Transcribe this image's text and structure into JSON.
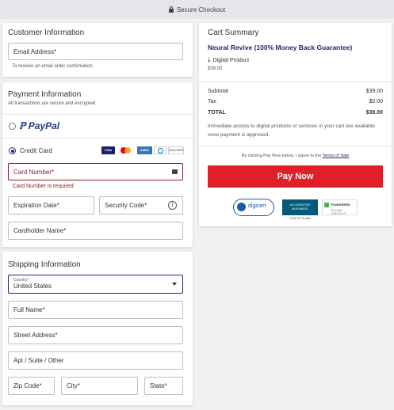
{
  "topbar": {
    "title": "Secure Checkout"
  },
  "customer": {
    "title": "Customer Information",
    "email_label": "Email Address*",
    "email_hint": "To receive an email order confirmation."
  },
  "payment": {
    "title": "Payment Information",
    "subtitle": "All transactions are secure and encrypted.",
    "paypal": "PayPal",
    "credit_card": "Credit Card",
    "card_icons": [
      "VISA",
      "mastercard",
      "AMEX",
      "diners",
      "DISCOVER"
    ],
    "card_number_label": "Card Number*",
    "card_number_error": "Card Number is required",
    "expiration_label": "Expiration Date*",
    "security_label": "Security Code*",
    "cardholder_label": "Cardholder Name*"
  },
  "shipping": {
    "title": "Shipping Information",
    "country_label": "Country*",
    "country_value": "United States",
    "full_name_label": "Full Name*",
    "street_label": "Street Address*",
    "apt_label": "Apt / Suite / Other",
    "zip_label": "Zip Code*",
    "city_label": "City*",
    "state_label": "State*"
  },
  "summary": {
    "title": "Cart Summary",
    "product_name": "Neural Revive (100% Money Back Guarantee)",
    "product_type": "Digital Product",
    "product_price": "$39.00",
    "subtotal_label": "Subtotal",
    "subtotal_value": "$39.00",
    "tax_label": "Tax",
    "tax_value": "$0.00",
    "total_label": "TOTAL",
    "total_value": "$39.00",
    "access_note": "Immediate access to digital products or services in your cart are available once payment is approved.",
    "terms_prefix": "By clicking Pay Now below, I agree to the",
    "terms_link": "Terms of Sale",
    "pay_button": "Pay Now",
    "badges": {
      "digicert": "digicert",
      "bbb_1": "ACCREDITED",
      "bbb_2": "BUSINESS",
      "bbb_click": "Click for Profile",
      "trusted_1": "TrustedSite",
      "trusted_2": "SECURE CHECKOUT"
    }
  },
  "colors": {
    "accent": "#1e2a6e",
    "pay_button": "#e02027",
    "error": "#8a1d22",
    "paypal_dark": "#253b80",
    "paypal_light": "#179bd7"
  }
}
